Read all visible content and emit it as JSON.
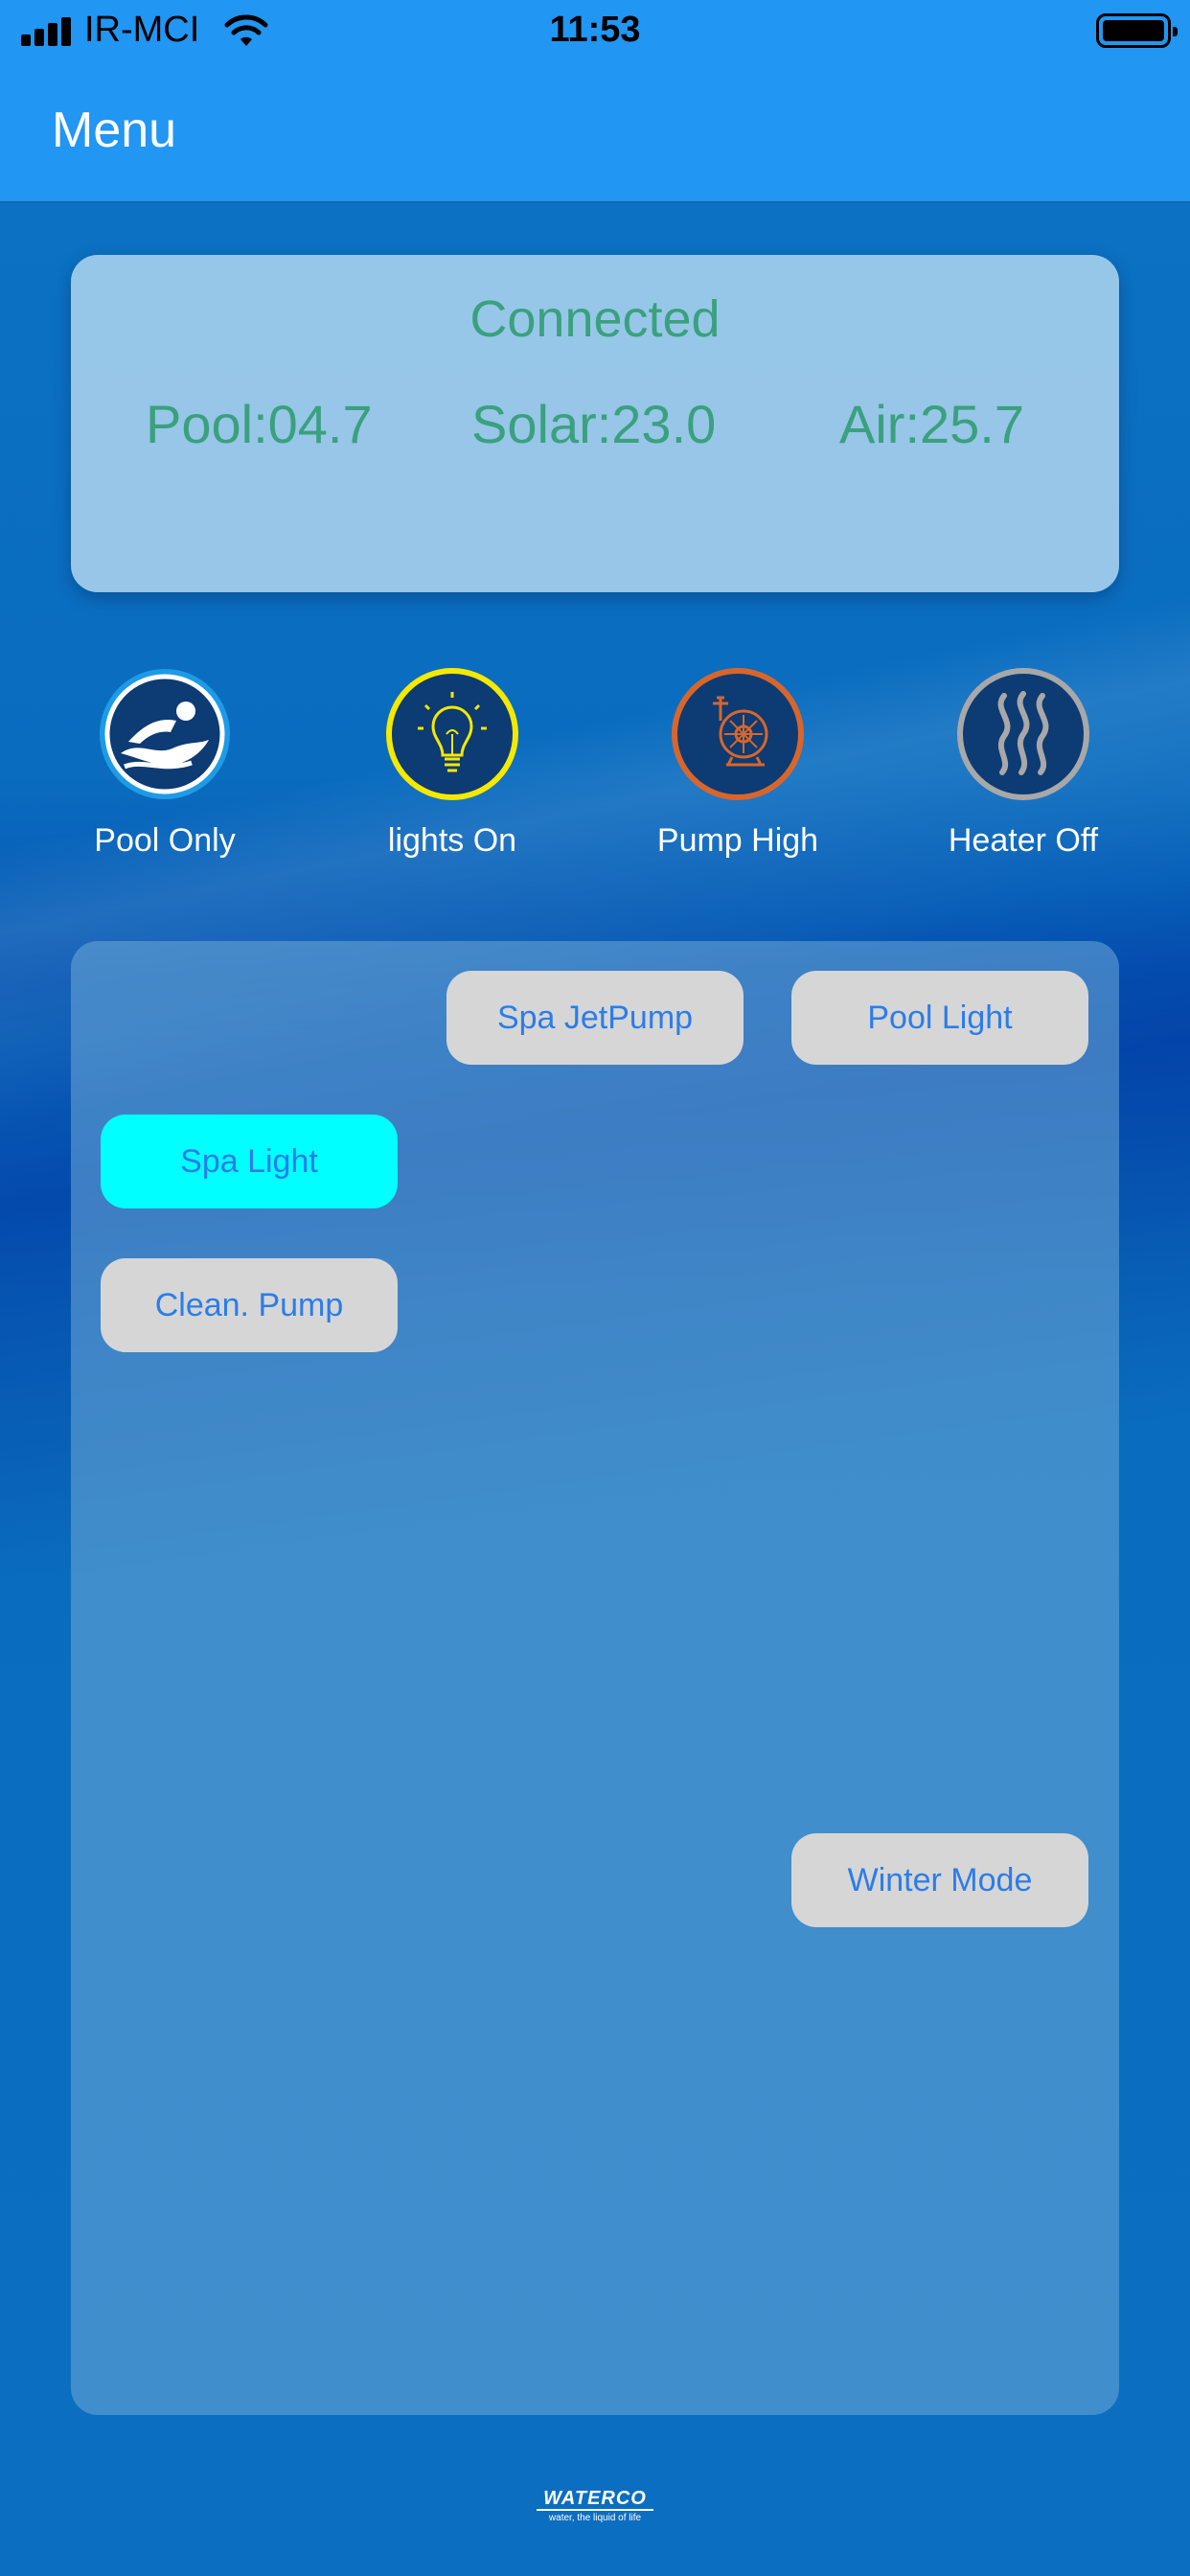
{
  "status_bar": {
    "carrier": "IR-MCI",
    "time": "11:53",
    "icons": [
      "signal-icon",
      "wifi-icon",
      "battery-icon"
    ]
  },
  "nav": {
    "title": "Menu"
  },
  "status_card": {
    "connection": "Connected",
    "pool": "Pool:04.7",
    "solar": "Solar:23.0",
    "air": "Air:25.7",
    "text_color": "#3aa17e"
  },
  "modes": [
    {
      "label": "Pool Only",
      "icon": "swimmer-icon",
      "color": "#1e9be6"
    },
    {
      "label": "lights On",
      "icon": "lightbulb-icon",
      "color": "#f5e900"
    },
    {
      "label": "Pump High",
      "icon": "pump-icon",
      "color": "#d8662a"
    },
    {
      "label": "Heater Off",
      "icon": "heat-waves-icon",
      "color": "#a8a8a8"
    }
  ],
  "controls": {
    "spa_jetpump": "Spa JetPump",
    "pool_light": "Pool Light",
    "spa_light": "Spa Light",
    "clean_pump": "Clean. Pump",
    "winter_mode": "Winter Mode",
    "active_color": "#00ffff",
    "inactive_color": "#d6d6d6",
    "text_color": "#2b7de9"
  },
  "footer": {
    "logo_word": "WATERCO",
    "logo_tagline": "water, the liquid of life"
  }
}
